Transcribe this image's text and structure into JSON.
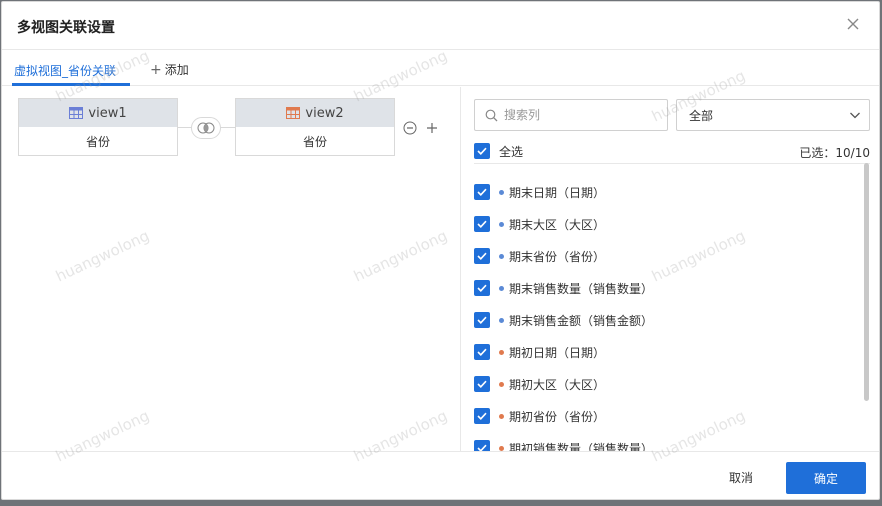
{
  "dialog": {
    "title": "多视图关联设置",
    "close_icon": "close-icon"
  },
  "tabs": {
    "active_label": "虚拟视图_省份关联",
    "add_label": "添加"
  },
  "join": {
    "left": {
      "name": "view1",
      "field": "省份",
      "icon": "table-icon",
      "color": "#6b7fd6"
    },
    "right": {
      "name": "view2",
      "field": "省份",
      "icon": "table-icon",
      "color": "#e07a4e"
    },
    "join_icon": "inner-join-icon"
  },
  "fields_panel": {
    "search_placeholder": "搜索列",
    "filter_value": "全部",
    "select_all_label": "全选",
    "selected_count": "已选：10/10",
    "items": [
      {
        "label": "期末日期（日期）",
        "dot_color": "#5b8ad6"
      },
      {
        "label": "期末大区（大区）",
        "dot_color": "#5b8ad6"
      },
      {
        "label": "期末省份（省份）",
        "dot_color": "#5b8ad6"
      },
      {
        "label": "期末销售数量（销售数量）",
        "dot_color": "#5b8ad6"
      },
      {
        "label": "期末销售金额（销售金额）",
        "dot_color": "#5b8ad6"
      },
      {
        "label": "期初日期（日期）",
        "dot_color": "#e07a4e"
      },
      {
        "label": "期初大区（大区）",
        "dot_color": "#e07a4e"
      },
      {
        "label": "期初省份（省份）",
        "dot_color": "#e07a4e"
      },
      {
        "label": "期初销售数量（销售数量）",
        "dot_color": "#e07a4e"
      }
    ]
  },
  "footer": {
    "cancel_label": "取消",
    "ok_label": "确定"
  },
  "watermark": "huangwolong",
  "colors": {
    "accent": "#1f6fd9"
  }
}
